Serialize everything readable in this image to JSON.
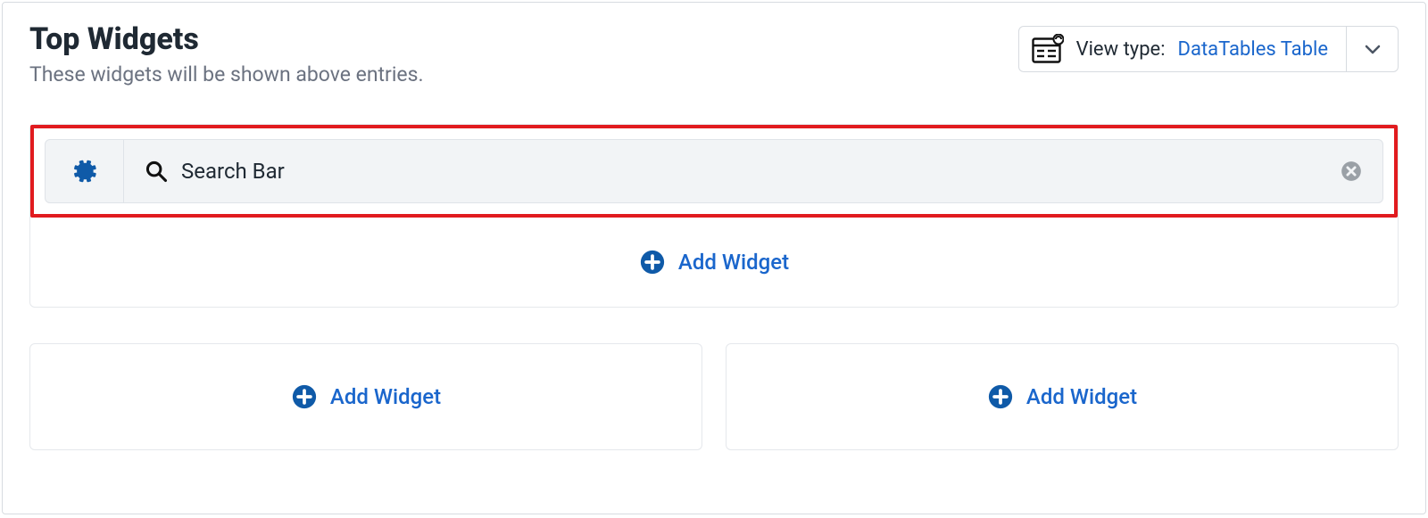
{
  "header": {
    "title": "Top Widgets",
    "subtitle": "These widgets will be shown above entries."
  },
  "view_type": {
    "label": "View type:",
    "value": "DataTables Table"
  },
  "widgets": [
    {
      "name": "Search Bar",
      "icon": "search"
    }
  ],
  "add_widget_label": "Add Widget",
  "colors": {
    "link": "#1a66cc",
    "highlight": "#e11b1f",
    "muted": "#6b7280",
    "text": "#1f2933"
  }
}
